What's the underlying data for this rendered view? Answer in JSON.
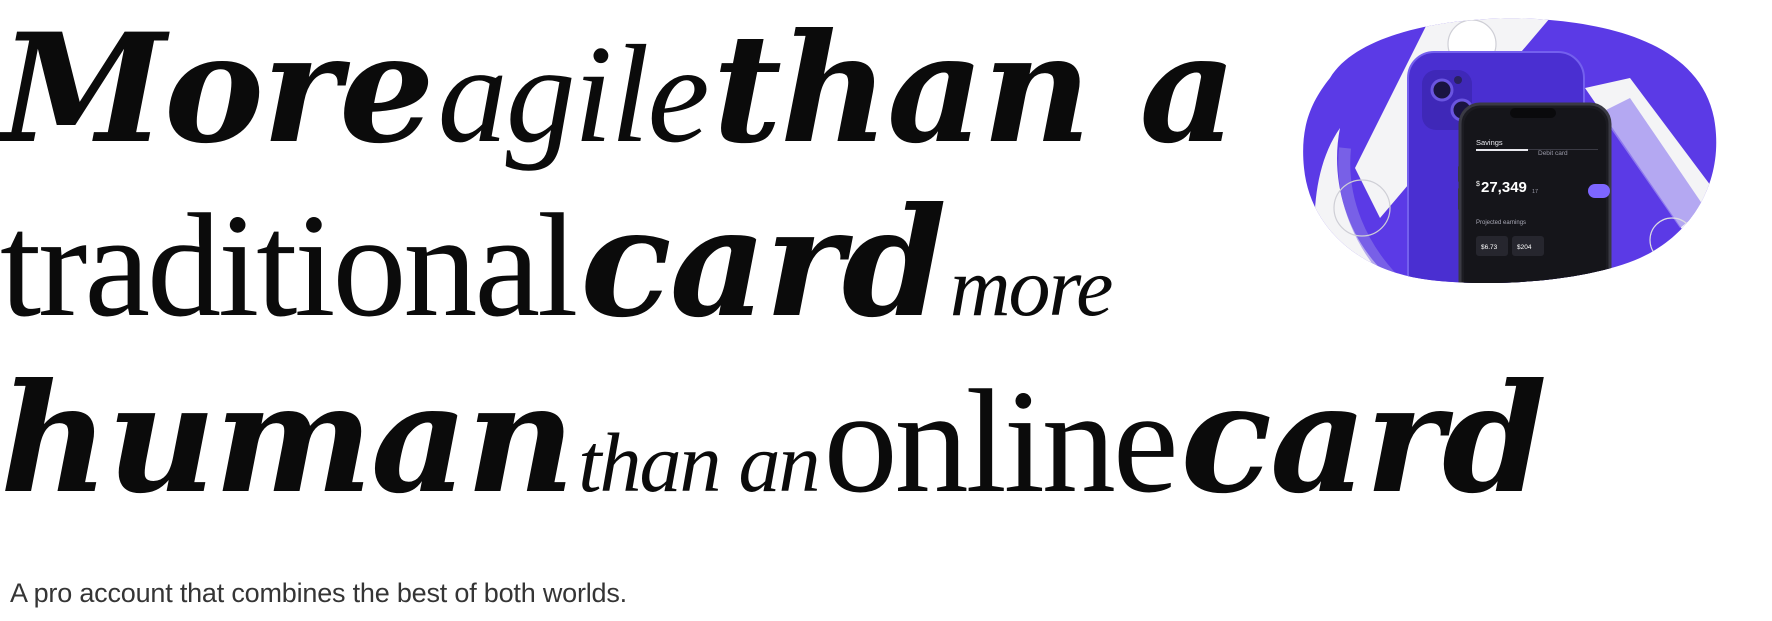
{
  "headline": {
    "line1": [
      "More",
      "agile",
      "than a"
    ],
    "line2": [
      "traditional",
      "card",
      "more"
    ],
    "line3": [
      "human",
      "than an",
      "online",
      "card"
    ]
  },
  "subtitle": "A pro account that combines the best of both worlds.",
  "phone": {
    "tab_savings": "Savings",
    "tab_debit": "Debit card",
    "currency": "$",
    "balance": "27,349",
    "balance_cents": "17",
    "projected_label": "Projected earnings",
    "chip1": "$6.73",
    "chip2": "$204"
  },
  "colors": {
    "accent": "#5b3ae6",
    "text": "#0b0b0b",
    "subtitle": "#353535"
  }
}
